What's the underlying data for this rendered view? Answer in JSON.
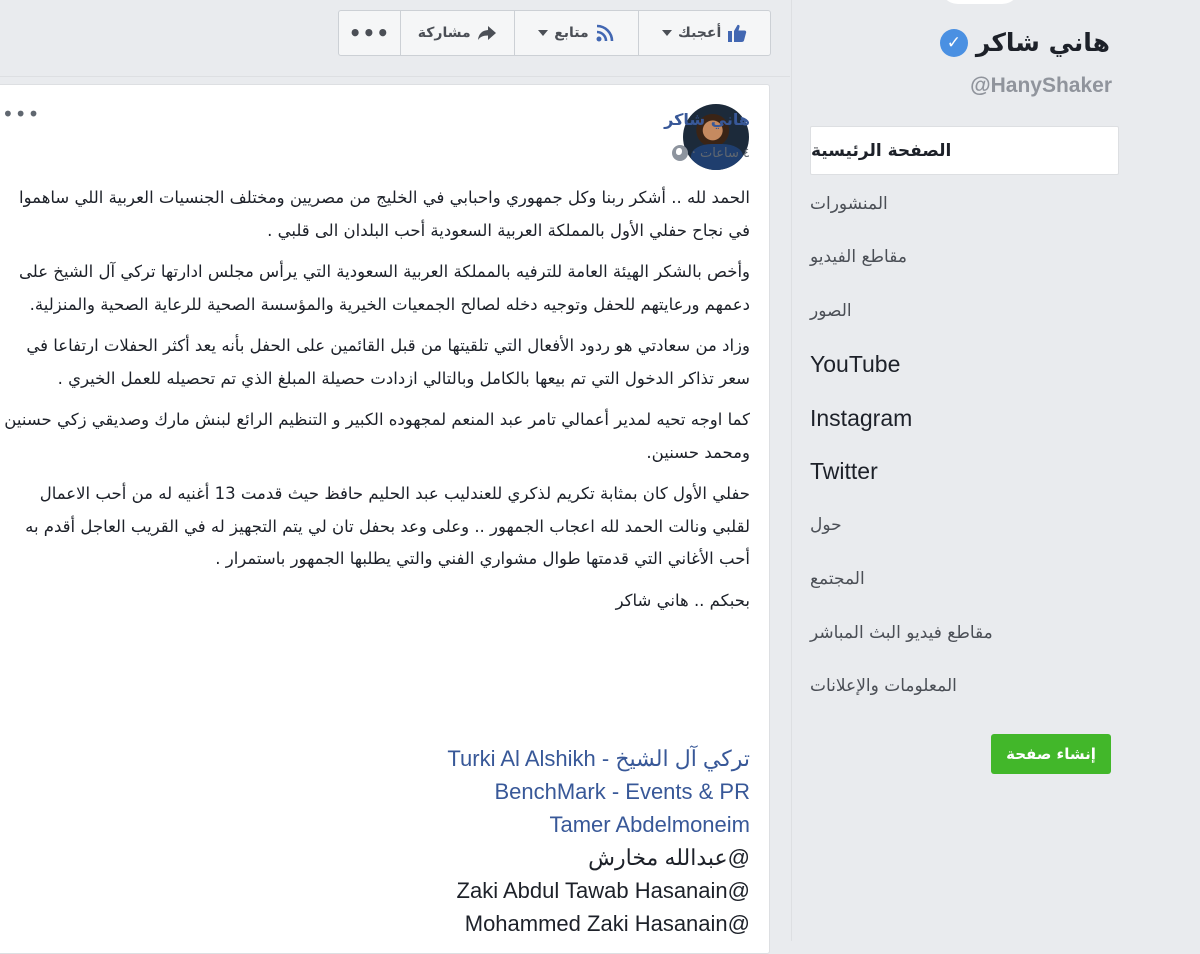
{
  "action_bar": {
    "more": "•••",
    "share": "مشاركة",
    "follow": "متابع",
    "like": "أعجبك"
  },
  "post": {
    "more": "•••",
    "author": "هاني شاكر",
    "time": "٤ ساعات ·",
    "paragraphs": [
      "الحمد لله .. أشكر ربنا وكل جمهوري واحبابي في الخليج من مصريين ومختلف الجنسيات العربية اللي ساهموا في نجاح حفلي الأول بالمملكة العربية السعودية أحب البلدان الى قلبي .",
      "وأخص بالشكر الهيئة العامة للترفيه بالمملكة العربية السعودية التي يرأس مجلس ادارتها تركي آل الشيخ على دعمهم ورعايتهم للحفل وتوجيه دخله لصالح الجمعيات الخيرية والمؤسسة الصحية للرعاية الصحية والمنزلية.",
      "وزاد من سعادتي هو ردود الأفعال التي تلقيتها من قبل القائمين على الحفل بأنه يعد أكثر الحفلات ارتفاعا في سعر تذاكر الدخول التي تم بيعها بالكامل وبالتالي ازدادت حصيلة المبلغ الذي تم تحصيله للعمل الخيري .",
      "كما اوجه تحيه لمدير أعمالي تامر عبد المنعم لمجهوده الكبير و التنظيم الرائع لبنش مارك وصديقي زكي حسنين ومحمد حسنين.",
      "حفلي الأول كان بمثابة تكريم لذكري للعندليب عبد الحليم حافظ حيث قدمت 13 أغنيه له من أحب الاعمال لقلبي ونالت الحمد لله اعجاب الجمهور .. وعلى وعد بحفل تان لي يتم التجهيز له في القريب العاجل أقدم به أحب الأغاني التي قدمتها طوال مشواري الفني والتي يطلبها الجمهور باستمرار ."
    ],
    "signature": "بحبكم .. هاني شاكر",
    "links": [
      {
        "text": "تركي آل الشيخ - Turki Al Alshikh",
        "style": "link"
      },
      {
        "text": "BenchMark - Events & PR",
        "style": "link"
      },
      {
        "text": "Tamer Abdelmoneim",
        "style": "link"
      },
      {
        "text": "@عبدالله مخارش",
        "style": "plain"
      },
      {
        "text": "@Zaki Abdul Tawab Hasanain",
        "style": "plain"
      },
      {
        "text": "@Mohammed Zaki Hasanain",
        "style": "plain"
      }
    ]
  },
  "profile": {
    "name": "هاني شاكر",
    "verified": "✓",
    "handle": "@HanyShaker"
  },
  "nav": {
    "items": [
      {
        "label": "الصفحة الرئيسية",
        "active": true
      },
      {
        "label": "المنشورات"
      },
      {
        "label": "مقاطع الفيديو"
      },
      {
        "label": "الصور"
      },
      {
        "label": "YouTube",
        "latin": true
      },
      {
        "label": "Instagram",
        "latin": true
      },
      {
        "label": "Twitter",
        "latin": true
      },
      {
        "label": "حول"
      },
      {
        "label": "المجتمع"
      },
      {
        "label": "مقاطع فيديو البث المباشر"
      },
      {
        "label": "المعلومات والإعلانات"
      }
    ]
  },
  "create_page": "إنشاء صفحة",
  "colors": {
    "link": "#385898",
    "accent_green": "#42b72a",
    "verified_blue": "#4a90e2",
    "background": "#e9ebee"
  }
}
